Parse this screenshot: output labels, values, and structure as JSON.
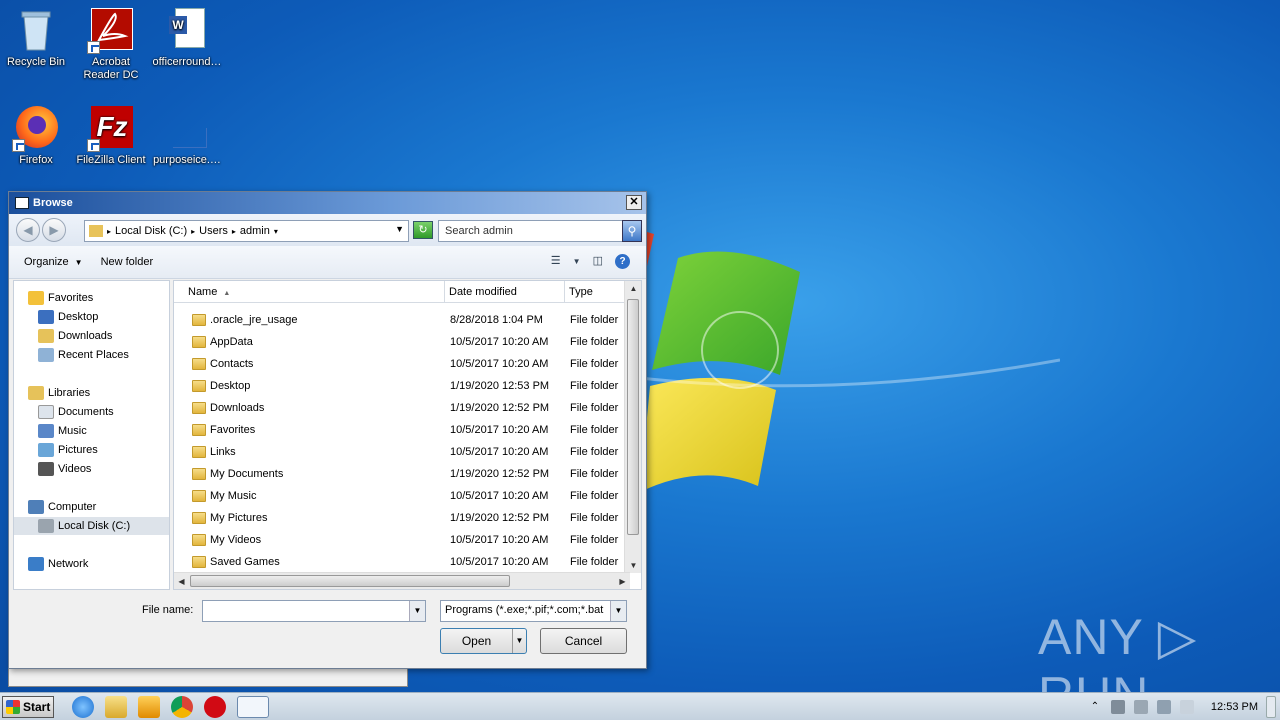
{
  "desktop": {
    "icons": [
      {
        "label": "Recycle Bin"
      },
      {
        "label": "Acrobat Reader DC"
      },
      {
        "label": "officerround…"
      },
      {
        "label": "Firefox"
      },
      {
        "label": "FileZilla Client"
      },
      {
        "label": "purposeice.…"
      }
    ],
    "watermark": "ANY ▷ RUN"
  },
  "dialog": {
    "title": "Browse",
    "close": "✕",
    "address": {
      "crumbs": [
        "Local Disk (C:)",
        "Users",
        "admin"
      ]
    },
    "search_placeholder": "Search admin",
    "toolbar": {
      "organize": "Organize",
      "new_folder": "New folder"
    },
    "nav": {
      "favorites": "Favorites",
      "fav_items": [
        "Desktop",
        "Downloads",
        "Recent Places"
      ],
      "libraries": "Libraries",
      "lib_items": [
        "Documents",
        "Music",
        "Pictures",
        "Videos"
      ],
      "computer": "Computer",
      "computer_items": [
        "Local Disk (C:)"
      ],
      "network": "Network"
    },
    "columns": {
      "name": "Name",
      "date": "Date modified",
      "type": "Type"
    },
    "rows": [
      {
        "name": ".oracle_jre_usage",
        "date": "8/28/2018 1:04 PM",
        "type": "File folder"
      },
      {
        "name": "AppData",
        "date": "10/5/2017 10:20 AM",
        "type": "File folder"
      },
      {
        "name": "Contacts",
        "date": "10/5/2017 10:20 AM",
        "type": "File folder"
      },
      {
        "name": "Desktop",
        "date": "1/19/2020 12:53 PM",
        "type": "File folder"
      },
      {
        "name": "Downloads",
        "date": "1/19/2020 12:52 PM",
        "type": "File folder"
      },
      {
        "name": "Favorites",
        "date": "10/5/2017 10:20 AM",
        "type": "File folder"
      },
      {
        "name": "Links",
        "date": "10/5/2017 10:20 AM",
        "type": "File folder"
      },
      {
        "name": "My Documents",
        "date": "1/19/2020 12:52 PM",
        "type": "File folder"
      },
      {
        "name": "My Music",
        "date": "10/5/2017 10:20 AM",
        "type": "File folder"
      },
      {
        "name": "My Pictures",
        "date": "1/19/2020 12:52 PM",
        "type": "File folder"
      },
      {
        "name": "My Videos",
        "date": "10/5/2017 10:20 AM",
        "type": "File folder"
      },
      {
        "name": "Saved Games",
        "date": "10/5/2017 10:20 AM",
        "type": "File folder"
      }
    ],
    "file_name_label": "File name:",
    "file_name_value": "",
    "file_type": "Programs (*.exe;*.pif;*.com;*.bat",
    "open": "Open",
    "cancel": "Cancel"
  },
  "taskbar": {
    "start": "Start",
    "clock": "12:53 PM"
  }
}
